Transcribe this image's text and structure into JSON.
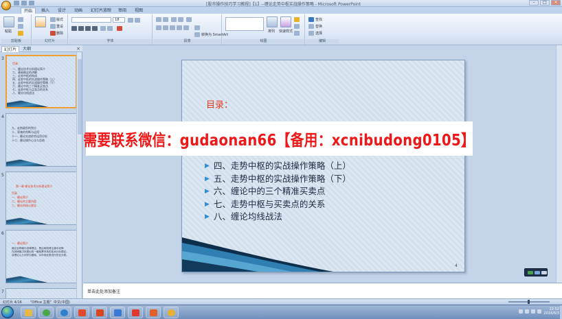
{
  "window": {
    "title": "[股市操作技巧学习教程]【1】--缠论走势中枢实战操作策略 - Microsoft PowerPoint"
  },
  "ribbon": {
    "tabs": [
      "开始",
      "插入",
      "设计",
      "动画",
      "幻灯片放映",
      "审阅",
      "视图"
    ],
    "active_tab": "开始",
    "groups": [
      "剪贴板",
      "幻灯片",
      "字体",
      "段落",
      "绘图",
      "编辑"
    ],
    "buttons": {
      "paste": "粘贴",
      "new_slide": "新建\n幻灯片",
      "layout": "版式",
      "reset": "重设",
      "delete": "删除",
      "font_size": "18",
      "convert_smartart": "转换为 SmartArt",
      "arrange": "排列",
      "quick_styles": "快速样式",
      "find": "查找",
      "replace": "替换",
      "select": "选择"
    }
  },
  "left_panel": {
    "tabs": [
      "幻灯片",
      "大纲"
    ],
    "slides": [
      {
        "number": "3",
        "title": "目录：",
        "lines": [
          "一、缠论技术分析理论简介",
          "二、基础概念的讲解",
          "三、走势中枢的构成",
          "四、走势中枢的实战操作策略（上）",
          "五、走势中枢的实战操作策略（下）",
          "六、缠论中的三个精准买卖点",
          "七、走势中枢与买卖点的关系",
          "八、缠论均线战法"
        ],
        "selected": true
      },
      {
        "number": "4",
        "title": "",
        "lines": [
          "九、走势级别的划分",
          "十、背驰的判断与运用",
          "十一、缠论实战综合运用分析",
          "十二、缠论操作心法与总结"
        ],
        "selected": false
      },
      {
        "number": "5",
        "title": "第一章 缠论技术分析理论简介",
        "lines": [
          "目录",
          "一、缠论简介",
          "二、缠论的主要内容",
          "三、缠论的核心理念"
        ],
        "selected": false
      },
      {
        "number": "6",
        "title": "一、缠论简介",
        "lines": [
          "缠论全称缠中说禅理论，是由网络博主缠中说禅",
          "在其博客中所提出的一套股票市场的技术分析理论。",
          "该理论以几何学为基础，对市场走势进行完全分类。"
        ],
        "selected": false
      }
    ],
    "partial_slide_number": "7"
  },
  "slide": {
    "title": "目录：",
    "items": [
      "四、走势中枢的实战操作策略（上）",
      "五、走势中枢的实战操作策略（下）",
      "六、缠论中的三个精准买卖点",
      "七、走势中枢与买卖点的关系",
      "八、缠论均线战法"
    ],
    "page_number": "4"
  },
  "overlay": {
    "text": "需要联系微信：gudaonan66【备用：xcnibudong0105】"
  },
  "notes": {
    "placeholder": "单击此处添加备注"
  },
  "status": {
    "slide_info": "幻灯片 4/16",
    "theme": "\"Office 主题\"",
    "language": "中文(中国)"
  },
  "taskbar": {
    "time": "22:52",
    "date": "2016/6/3"
  },
  "colors": {
    "slide_title": "#e53a1c",
    "bullet": "#2f8fd6",
    "overlay_text": "#ee1818",
    "selection": "#f0a030"
  }
}
